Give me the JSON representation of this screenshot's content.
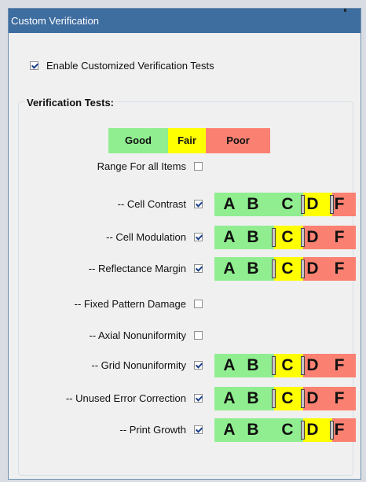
{
  "dialog": {
    "title": "Custom Verification",
    "enable_label": "Enable Customized Verification Tests",
    "enable_checked": true,
    "group_title": "Verification Tests:"
  },
  "legend": [
    {
      "label": "Good",
      "color": "#90ee90"
    },
    {
      "label": "Fair",
      "color": "#ffff00"
    },
    {
      "label": "Poor",
      "color": "#fa8072"
    }
  ],
  "grades": [
    "A",
    "B",
    "C",
    "D",
    "F"
  ],
  "rows": [
    {
      "label": "Range For all Items",
      "checked": false,
      "fair_start": null,
      "poor_start": null
    },
    {
      "label": "-- Cell Contrast",
      "checked": true,
      "fair_start": "D",
      "poor_start": "F"
    },
    {
      "label": "-- Cell Modulation",
      "checked": true,
      "fair_start": "C",
      "poor_start": "D"
    },
    {
      "label": "-- Reflectance Margin",
      "checked": true,
      "fair_start": "C",
      "poor_start": "D"
    },
    {
      "label": "-- Fixed Pattern Damage",
      "checked": false,
      "fair_start": null,
      "poor_start": null
    },
    {
      "label": "-- Axial Nonuniformity",
      "checked": false,
      "fair_start": null,
      "poor_start": null
    },
    {
      "label": "-- Grid Nonuniformity",
      "checked": true,
      "fair_start": "C",
      "poor_start": "D"
    },
    {
      "label": "-- Unused Error Correction",
      "checked": true,
      "fair_start": "C",
      "poor_start": "D"
    },
    {
      "label": "-- Print Growth",
      "checked": true,
      "fair_start": "D",
      "poor_start": "F"
    }
  ]
}
